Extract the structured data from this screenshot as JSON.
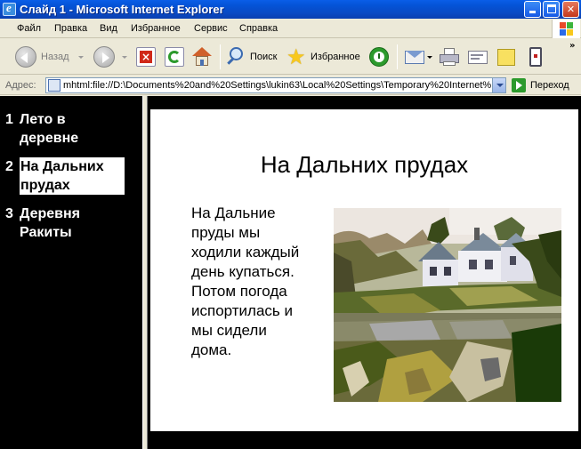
{
  "window": {
    "title": "Слайд 1 - Microsoft Internet Explorer"
  },
  "menu": [
    "Файл",
    "Правка",
    "Вид",
    "Избранное",
    "Сервис",
    "Справка"
  ],
  "toolbar": {
    "back_label": "Назад",
    "search_label": "Поиск",
    "favorites_label": "Избранное"
  },
  "address": {
    "label": "Адрес:",
    "value": "mhtml:file://D:\\Documents%20and%20Settings\\lukin63\\Local%20Settings\\Temporary%20Internet%",
    "go_label": "Переход"
  },
  "outline": {
    "items": [
      {
        "num": "1",
        "line1": "Лето в",
        "line2": "деревне"
      },
      {
        "num": "2",
        "line1": "На Дальних",
        "line2": "прудах"
      },
      {
        "num": "3",
        "line1": "Деревня",
        "line2": "Ракиты"
      }
    ],
    "active_index": 1
  },
  "slide": {
    "title": "На Дальних прудах",
    "body_lines": [
      "На Дальние",
      "пруды мы",
      "ходили каждый",
      "день купаться.",
      "Потом погода",
      "испортилась и",
      "мы сидели",
      "дома."
    ]
  }
}
